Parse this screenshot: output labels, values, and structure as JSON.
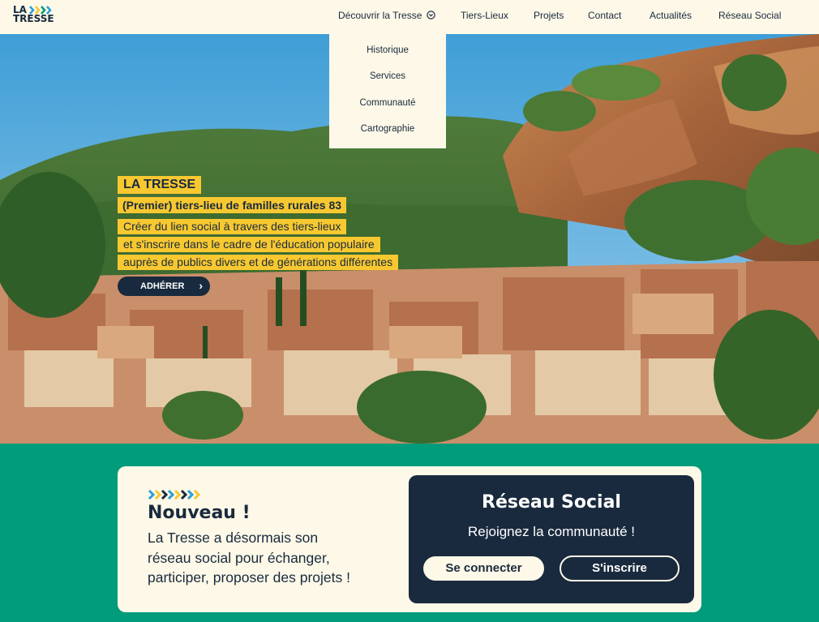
{
  "brand": {
    "line1": "LA",
    "line2": "TRESSE"
  },
  "nav": {
    "decouvrir": "Découvrir la Tresse",
    "tiers_lieux": "Tiers-Lieux",
    "projets": "Projets",
    "contact": "Contact",
    "actualites": "Actualités",
    "reseau_social": "Réseau Social"
  },
  "dropdown": {
    "items": [
      "Historique",
      "Services",
      "Communauté",
      "Cartographie"
    ]
  },
  "hero": {
    "title": "LA TRESSE",
    "subtitle": "(Premier) tiers-lieu de familles rurales 83",
    "lines": [
      "Créer du lien social à travers des tiers-lieux",
      "et s'inscrire dans le cadre de l'éducation populaire",
      "auprès de publics divers et de générations différentes"
    ],
    "cta": "ADHÉRER"
  },
  "promo": {
    "heading": "Nouveau !",
    "text_lines": [
      "La Tresse a désormais son",
      "réseau social pour échanger,",
      "participer, proposer des projets !"
    ]
  },
  "social": {
    "title": "Réseau Social",
    "subtitle": "Rejoignez la communauté !",
    "login": "Se connecter",
    "signup": "S'inscrire"
  },
  "colors": {
    "navy": "#192a3e",
    "cream": "#fdf8e7",
    "green": "#009c7c",
    "yellow": "#f7c830",
    "chevron_blue": "#2a9fd8"
  }
}
